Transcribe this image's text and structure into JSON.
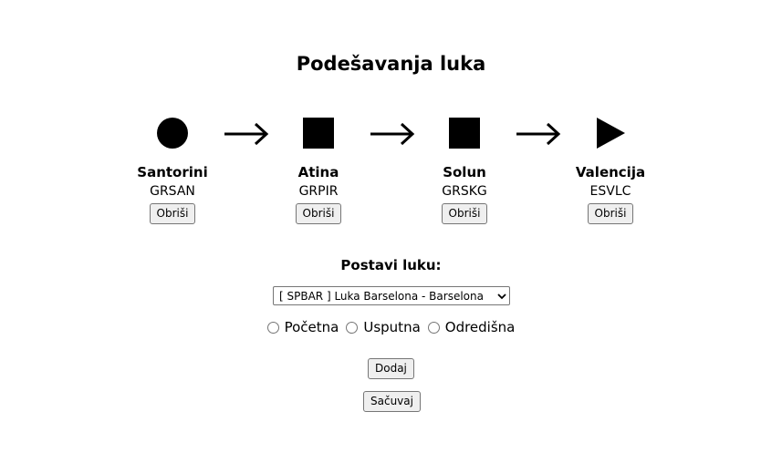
{
  "page": {
    "title": "Podešavanja luka"
  },
  "route": {
    "stops": [
      {
        "shape": "circle-icon",
        "name": "Santorini",
        "code": "GRSAN",
        "delete_label": "Obriši"
      },
      {
        "shape": "square-icon",
        "name": "Atina",
        "code": "GRPIR",
        "delete_label": "Obriši"
      },
      {
        "shape": "square-icon",
        "name": "Solun",
        "code": "GRSKG",
        "delete_label": "Obriši"
      },
      {
        "shape": "triangle-icon",
        "name": "Valencija",
        "code": "ESVLC",
        "delete_label": "Obriši"
      }
    ],
    "connector_icon": "arrow-right-icon"
  },
  "form": {
    "label": "Postavi luku:",
    "port_select": {
      "selected": "[ SPBAR ] Luka Barselona - Barselona"
    },
    "type_options": [
      {
        "label": "Početna",
        "checked": false
      },
      {
        "label": "Usputna",
        "checked": false
      },
      {
        "label": "Odredišna",
        "checked": false
      }
    ],
    "add_label": "Dodaj",
    "save_label": "Sačuvaj"
  }
}
